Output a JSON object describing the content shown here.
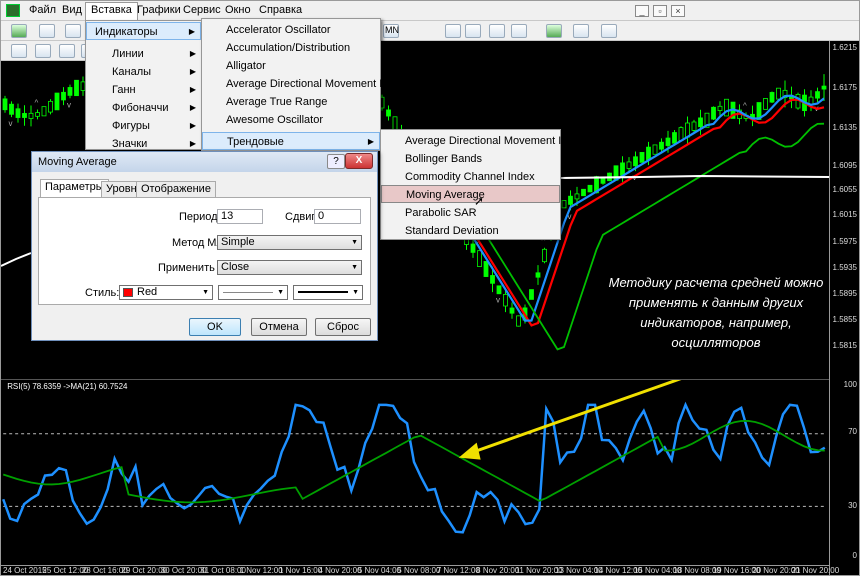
{
  "menubar": {
    "items": [
      "Файл",
      "Вид",
      "Вставка",
      "Графики",
      "Сервис",
      "Окно",
      "Справка"
    ],
    "active": "Вставка"
  },
  "toolbar": {
    "timeframe_label": "MN"
  },
  "insert_menu": {
    "items": [
      {
        "label": "Индикаторы",
        "submenu": true,
        "highlighted": true
      },
      {
        "label": "Линии",
        "submenu": true
      },
      {
        "label": "Каналы",
        "submenu": true
      },
      {
        "label": "Ганн",
        "submenu": true
      },
      {
        "label": "Фибоначчи",
        "submenu": true
      },
      {
        "label": "Фигуры",
        "submenu": true
      },
      {
        "label": "Значки",
        "submenu": true
      }
    ]
  },
  "indicators_menu": {
    "items": [
      {
        "label": "Accelerator Oscillator"
      },
      {
        "label": "Accumulation/Distribution"
      },
      {
        "label": "Alligator"
      },
      {
        "label": "Average Directional Movement Index"
      },
      {
        "label": "Average True Range"
      },
      {
        "label": "Awesome Oscillator"
      },
      {
        "label": "Трендовые",
        "submenu": true,
        "highlighted": true
      }
    ]
  },
  "trend_menu": {
    "items": [
      {
        "label": "Average Directional Movement Index"
      },
      {
        "label": "Bollinger Bands"
      },
      {
        "label": "Commodity Channel Index"
      },
      {
        "label": "Moving Average",
        "highlighted": true
      },
      {
        "label": "Parabolic SAR"
      },
      {
        "label": "Standard Deviation"
      }
    ]
  },
  "dialog": {
    "title": "Moving Average",
    "help_label": "?",
    "close_label": "X",
    "tabs": [
      "Параметры",
      "Уровни",
      "Отображение"
    ],
    "period_label": "Период:",
    "period_value": "13",
    "shift_label": "Сдвиг:",
    "shift_value": "0",
    "method_label": "Метод МА:",
    "method_value": "Simple",
    "apply_label": "Применить к:",
    "apply_value": "Close",
    "style_label": "Стиль:",
    "style_color_name": "Red",
    "style_color": "#ff0000",
    "ok_label": "OK",
    "cancel_label": "Отмена",
    "reset_label": "Сброс"
  },
  "rsi_panel": {
    "label": "RSI(5) 78.6359  ->MA(21) 60.7524",
    "level_high": "70",
    "level_low": "30",
    "scale_top": "100",
    "scale_bottom": "0"
  },
  "price_axis": [
    "1.6215",
    "1.6175",
    "1.6135",
    "1.6095",
    "1.6055",
    "1.6015",
    "1.5975",
    "1.5935",
    "1.5895",
    "1.5855",
    "1.5815"
  ],
  "time_axis": [
    "24 Oct 2015",
    "25 Oct 12:00",
    "28 Oct 16:00",
    "29 Oct 20:00",
    "30 Oct 20:00",
    "31 Oct 08:00",
    "1 Nov 12:00",
    "1 Nov 16:00",
    "4 Nov 20:00",
    "5 Nov 04:00",
    "5 Nov 08:00",
    "7 Nov 12:00",
    "8 Nov 20:00",
    "11 Nov 20:00",
    "13 Nov 04:00",
    "14 Nov 12:00",
    "15 Nov 04:00",
    "18 Nov 08:00",
    "19 Nov 16:00",
    "20 Nov 20:00",
    "21 Nov 20:00"
  ],
  "annotation": "Методику расчета средней можно применять к данным других индикаторов, например, осцилляторов",
  "colors": {
    "candle": "#00ff00",
    "ma_red": "#ff0000",
    "ma_blue": "#1e90ff",
    "ma_green": "#00c000",
    "rsi_line": "#1e90ff",
    "rsi_ma": "#00a000",
    "annotation_arrow": "#f0e000"
  }
}
